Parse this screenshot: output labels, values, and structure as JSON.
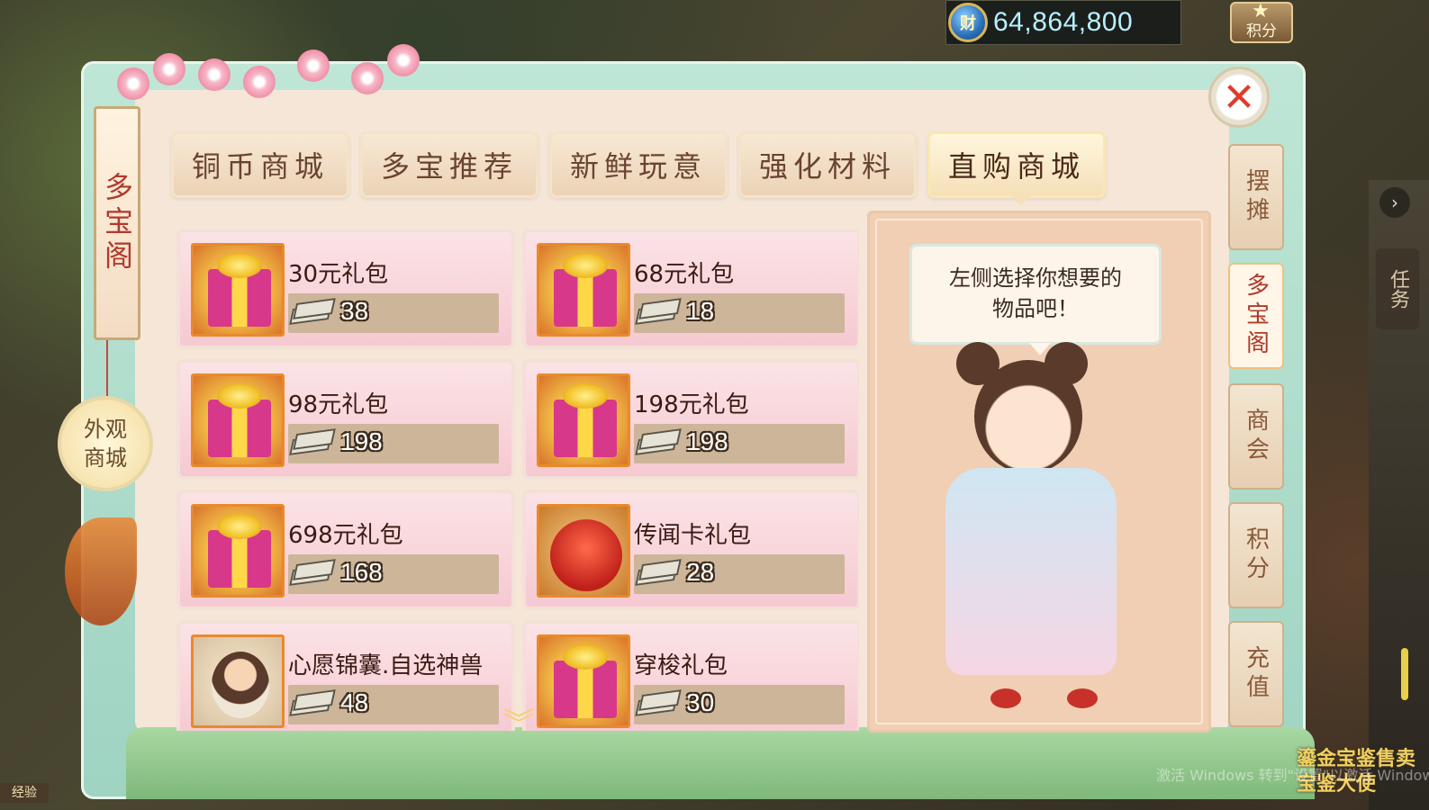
{
  "currency": {
    "icon": "money-coin-icon",
    "symbol": "财",
    "value": "64,864,800"
  },
  "points_button": {
    "label": "积分",
    "icon": "star-icon"
  },
  "panel_title": "多宝阁",
  "appearance_shop": {
    "line1": "外观",
    "line2": "商城"
  },
  "tabs": [
    {
      "label": "铜币商城",
      "active": false
    },
    {
      "label": "多宝推荐",
      "active": false
    },
    {
      "label": "新鲜玩意",
      "active": false
    },
    {
      "label": "强化材料",
      "active": false
    },
    {
      "label": "直购商城",
      "active": true
    }
  ],
  "items": [
    {
      "name": "30元礼包",
      "price": "38",
      "icon": "gift-box-icon"
    },
    {
      "name": "68元礼包",
      "price": "18",
      "icon": "gift-box-icon"
    },
    {
      "name": "98元礼包",
      "price": "198",
      "icon": "gift-box-icon"
    },
    {
      "name": "198元礼包",
      "price": "198",
      "icon": "gift-box-icon"
    },
    {
      "name": "698元礼包",
      "price": "168",
      "icon": "gift-box-icon"
    },
    {
      "name": "传闻卡礼包",
      "price": "28",
      "icon": "red-pouch-icon"
    },
    {
      "name": "心愿锦囊.自选神兽",
      "price": "48",
      "icon": "pet-character-icon"
    },
    {
      "name": "穿梭礼包",
      "price": "30",
      "icon": "gift-box-icon"
    }
  ],
  "price_currency_icon": "cash-stack-icon",
  "preview": {
    "bubble_line1": "左侧选择你想要的",
    "bubble_line2": "物品吧！",
    "character": "shop-girl-character"
  },
  "side_tabs": [
    {
      "label": "摆摊",
      "active": false
    },
    {
      "label": "多宝阁",
      "active": true
    },
    {
      "label": "商会",
      "active": false
    },
    {
      "label": "积分",
      "active": false
    },
    {
      "label": "充值",
      "active": false
    }
  ],
  "task_tab": "任务",
  "exp_label": "经验",
  "bottom_right": {
    "line1": "鎏金宝鉴售卖",
    "line2": "宝鉴大使"
  },
  "watermark": "激活 Windows 转到\"设置\"以激活 Windows。",
  "colors": {
    "accent_red": "#b03a2e",
    "frame_green": "#bfe6d6",
    "panel_bg": "#f5e6d8",
    "item_pink": "#f6c9d2"
  }
}
